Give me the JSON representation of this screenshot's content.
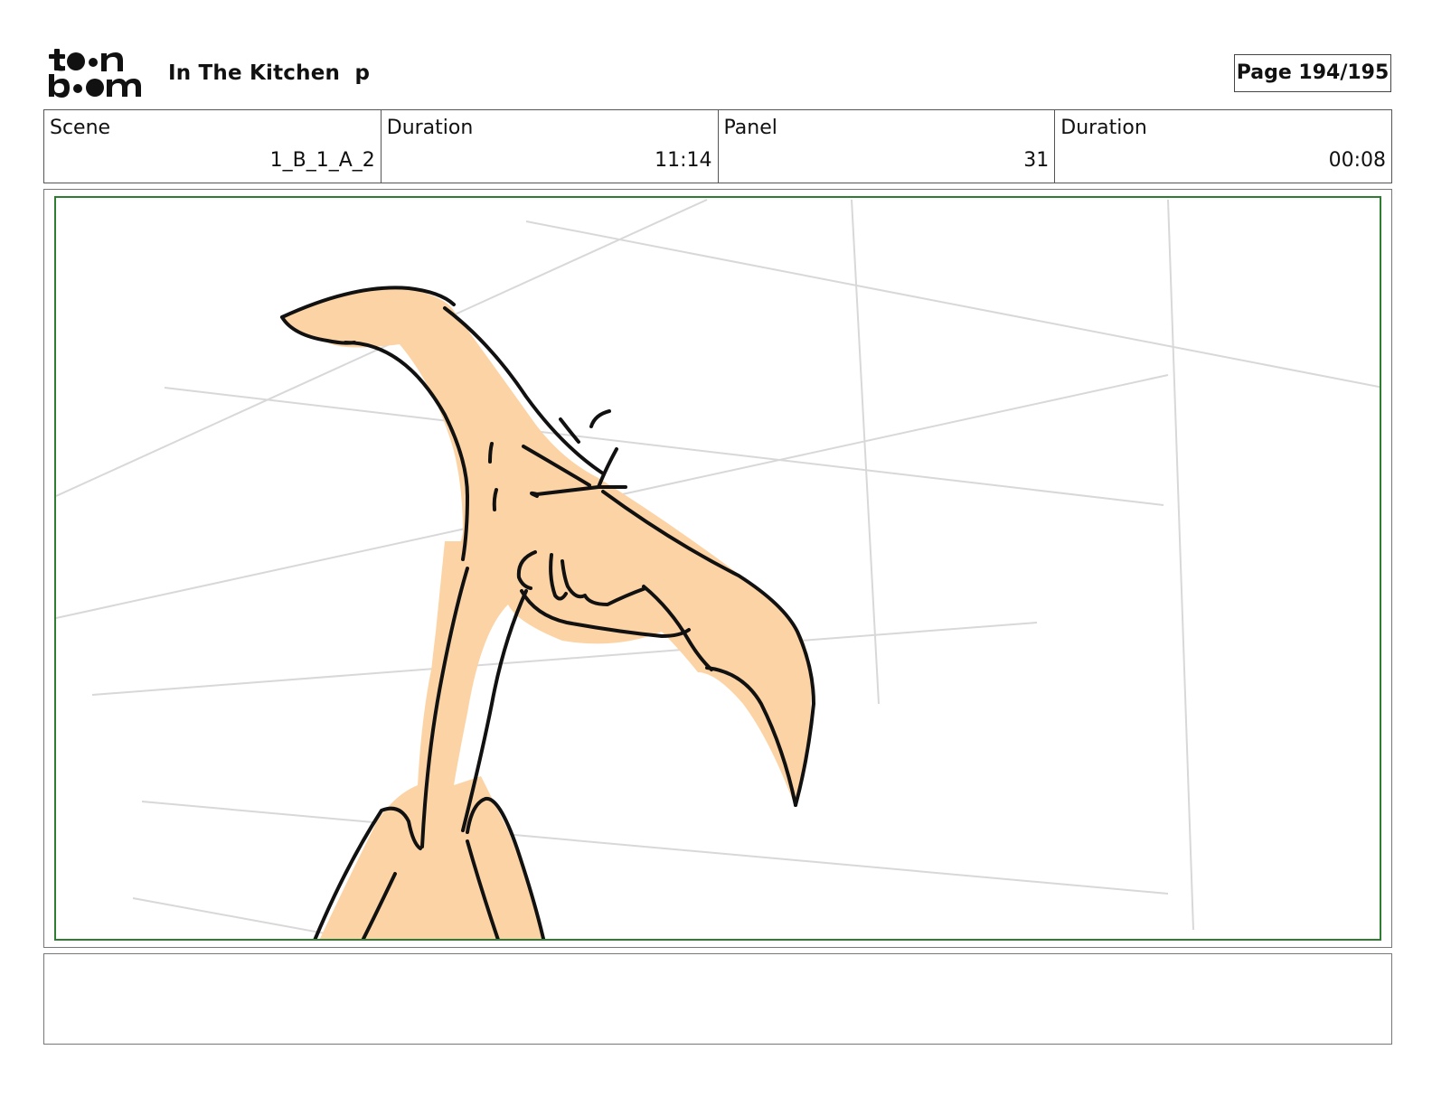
{
  "header": {
    "logo": {
      "icon": "toonboom-logo-icon",
      "text_line_1": "toon",
      "text_line_2": "boom"
    },
    "project_title": "In The Kitchen  p",
    "page_label": "Page 194/195"
  },
  "info": {
    "scene_label": "Scene",
    "scene_value": "1_B_1_A_2",
    "scene_duration_label": "Duration",
    "scene_duration_value": "11:14",
    "panel_label": "Panel",
    "panel_value": "31",
    "panel_duration_label": "Duration",
    "panel_duration_value": "00:08"
  },
  "panel": {
    "safe_area_color": "#2e7d32",
    "skin_color": "#fcd3a4",
    "line_color": "#111111",
    "guide_line_color": "#d8d8d8",
    "drawing_icon": "character-sketch-illustration"
  },
  "notes": {
    "text": ""
  }
}
